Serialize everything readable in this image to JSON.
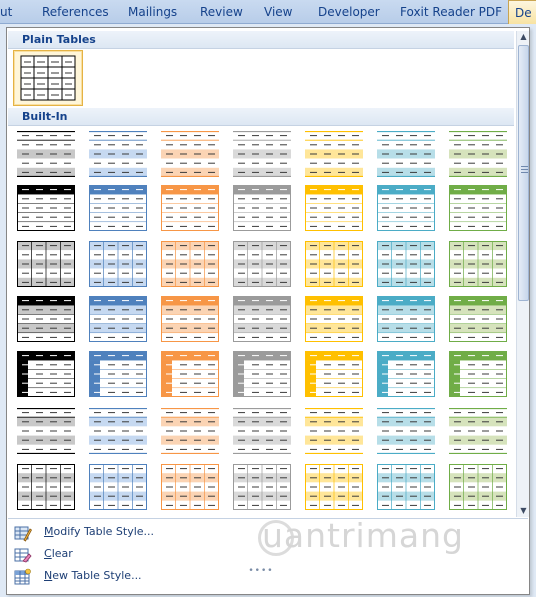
{
  "ribbon": {
    "tabs": [
      "ut",
      "References",
      "Mailings",
      "Review",
      "View",
      "Developer",
      "Foxit Reader PDF",
      "De"
    ],
    "active_tab_index": 7
  },
  "gallery": {
    "plain_section_title": "Plain Tables",
    "builtin_section_title": "Built-In",
    "accent_colors": [
      "#000000",
      "#4f81bd",
      "#f79646",
      "#9b9b9b",
      "#ffc000",
      "#4bacc6",
      "#70ad47"
    ],
    "light_fills": [
      "#c8c8c8",
      "#c6d9f1",
      "#fbd4b4",
      "#d9d9d9",
      "#ffe699",
      "#b7dee8",
      "#d6e3bc"
    ],
    "row_styles": [
      "light-shading",
      "header-accent",
      "grid-accent",
      "medium-shading",
      "dark-header-column",
      "light-list",
      "light-grid-column"
    ]
  },
  "menu": {
    "modify": {
      "prefix": "",
      "underline": "M",
      "rest": "odify Table Style..."
    },
    "clear": {
      "prefix": "",
      "underline": "C",
      "rest": "lear"
    },
    "new": {
      "prefix": "",
      "underline": "N",
      "rest": "ew Table Style..."
    }
  },
  "watermark": "uantrimang"
}
